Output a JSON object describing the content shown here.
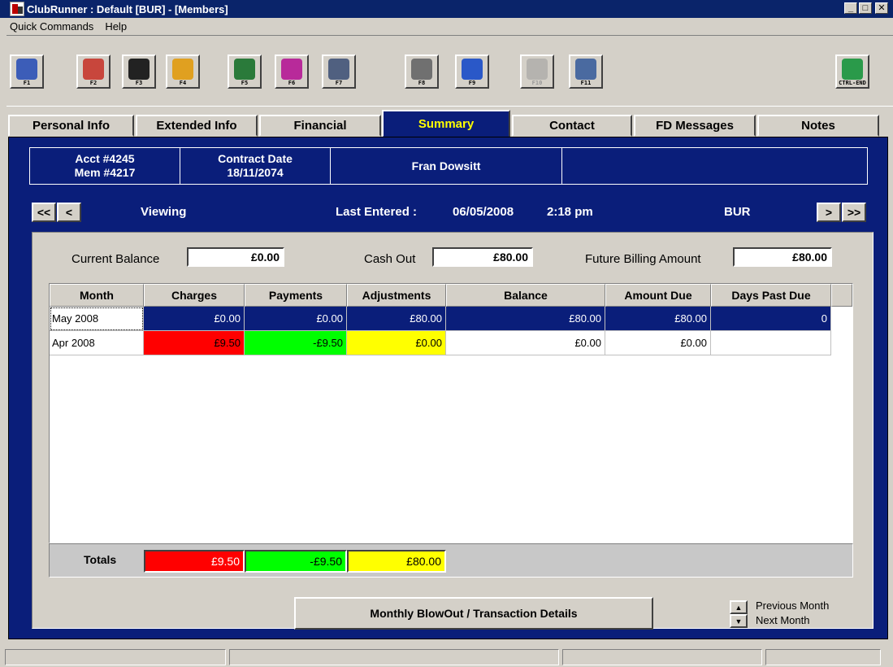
{
  "window": {
    "title": "ClubRunner : Default [BUR] - [Members]",
    "min_label": "_",
    "max_label": "□",
    "close_label": "✕"
  },
  "menu": [
    {
      "label": "Quick Commands"
    },
    {
      "label": "Help"
    }
  ],
  "toolbar": [
    {
      "key": "F1",
      "icon": "view-document-icon",
      "color": "#3c5db8"
    },
    {
      "key": "F2",
      "icon": "edit-person-icon",
      "color": "#c8463c"
    },
    {
      "key": "F3",
      "icon": "bomb-icon",
      "color": "#222222"
    },
    {
      "key": "F4",
      "icon": "person-highlight-icon",
      "color": "#e0a020"
    },
    {
      "key": "F5",
      "icon": "globe-search-icon",
      "color": "#2a7a3a"
    },
    {
      "key": "F6",
      "icon": "bar-chart-icon",
      "color": "#b82a9a"
    },
    {
      "key": "F7",
      "icon": "graph-pencil-icon",
      "color": "#506080"
    },
    {
      "key": "F8",
      "icon": "clock-calendar-icon",
      "color": "#707070"
    },
    {
      "key": "F9",
      "icon": "cash-register-icon",
      "color": "#2a58c8"
    },
    {
      "key": "F10",
      "icon": "network-icon",
      "color": "#909090",
      "disabled": true
    },
    {
      "key": "F11",
      "icon": "tools-icon",
      "color": "#4a6aa0"
    },
    {
      "key": "CTRL-END",
      "icon": "exit-door-icon",
      "color": "#2a9a4a"
    }
  ],
  "tabs": [
    {
      "label": "Personal Info",
      "active": false
    },
    {
      "label": "Extended Info",
      "active": false
    },
    {
      "label": "Financial",
      "active": false
    },
    {
      "label": "Summary",
      "active": true
    },
    {
      "label": "Contact",
      "active": false
    },
    {
      "label": "FD Messages",
      "active": false
    },
    {
      "label": "Notes",
      "active": false
    }
  ],
  "header": {
    "acct": "Acct #4245",
    "mem": "Mem #4217",
    "contract_label": "Contract Date",
    "contract_date": "18/11/2074",
    "name": "Fran Dowsitt",
    "extra": ""
  },
  "nav": {
    "first": "<<",
    "prev": "<",
    "next": ">",
    "last": ">>",
    "mode": "Viewing",
    "last_entered_label": "Last Entered :",
    "last_entered_date": "06/05/2008",
    "last_entered_time": "2:18 pm",
    "club": "BUR"
  },
  "balances": {
    "current_label": "Current Balance",
    "current_value": "£0.00",
    "cashout_label": "Cash Out",
    "cashout_value": "£80.00",
    "future_label": "Future Billing Amount",
    "future_value": "£80.00"
  },
  "grid": {
    "columns": [
      "Month",
      "Charges",
      "Payments",
      "Adjustments",
      "Balance",
      "Amount Due",
      "Days Past Due"
    ],
    "rows": [
      {
        "month": "May 2008",
        "charges": "£0.00",
        "payments": "£0.00",
        "adjustments": "£80.00",
        "balance": "£80.00",
        "amount_due": "£80.00",
        "days": "0"
      },
      {
        "month": "Apr 2008",
        "charges": "£9.50",
        "payments": "-£9.50",
        "adjustments": "£0.00",
        "balance": "£0.00",
        "amount_due": "£0.00",
        "days": ""
      }
    ]
  },
  "totals": {
    "label": "Totals",
    "charges": "£9.50",
    "payments": "-£9.50",
    "adjustments": "£80.00"
  },
  "colors": {
    "charges": "#ff0000",
    "payments": "#00ff00",
    "adjustments": "#ffff00",
    "panel": "#0a1e7a",
    "active_tab_text": "#ffff00"
  },
  "actions": {
    "blowout_label": "Monthly BlowOut / Transaction Details",
    "prev_month": "Previous Month",
    "next_month": "Next Month"
  }
}
